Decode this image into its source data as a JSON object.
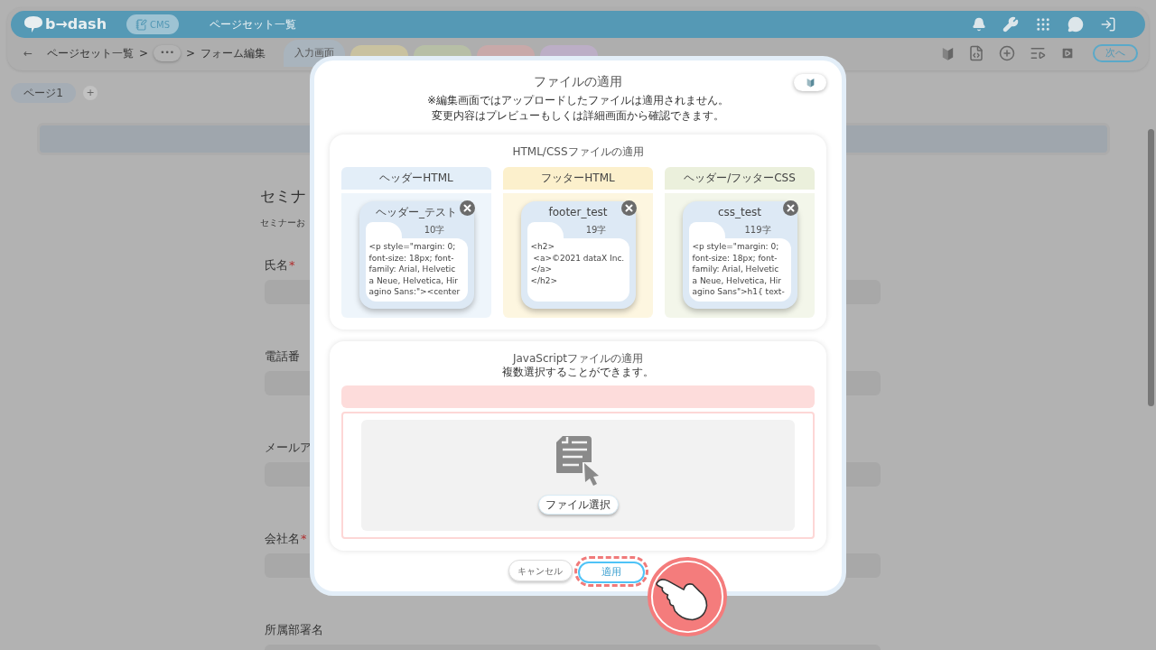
{
  "header": {
    "logo": "b→dash",
    "cms_badge": "CMS",
    "page_title": "ページセット一覧"
  },
  "breadcrumb": {
    "back": "←",
    "items": [
      {
        "kind": "link",
        "label": "ページセット一覧"
      },
      {
        "kind": "separator",
        "label": ">"
      },
      {
        "kind": "more",
        "label": "•••"
      },
      {
        "kind": "separator",
        "label": ">"
      },
      {
        "kind": "text",
        "label": "フォーム編集"
      }
    ]
  },
  "screen_tabs": [
    {
      "label": "入力画面",
      "selected": true,
      "color": "#a9b4bd"
    },
    {
      "selected": false,
      "color": "#c9c2a0"
    },
    {
      "selected": false,
      "color": "#b7bfa6"
    },
    {
      "selected": false,
      "color": "#c8a9a9"
    },
    {
      "selected": false,
      "color": "#bcaec6"
    }
  ],
  "next_button": "次へ",
  "pages": [
    {
      "label": "ページ1",
      "selected": true
    }
  ],
  "add_page": "+",
  "form": {
    "title": "セミナ",
    "description": "セミナーお",
    "required_mark": "*",
    "fields": [
      {
        "label": "氏名",
        "required": true
      },
      {
        "label": "電話番",
        "required": false
      },
      {
        "label": "メールア",
        "required": false
      },
      {
        "label": "会社名",
        "required": true
      },
      {
        "label": "所属部署名",
        "required": false
      }
    ]
  },
  "modal": {
    "title": "ファイルの適用",
    "notes": [
      "※編集画面ではアップロードしたファイルは適用されません。",
      "変更内容はプレビューもしくは詳細画面から確認できます。"
    ],
    "html_css": {
      "title": "HTML/CSSファイルの適用",
      "columns": [
        {
          "heading": "ヘッダーHTML",
          "color": "#e3eef8",
          "file": {
            "name": "ヘッダー_テスト",
            "count": "10字",
            "lines": [
              "<p style=\"margin: 0;",
              "font-size: 18px; font-",
              "family: Arial, Helvetic",
              "a Neue, Helvetica, Hir",
              "agino Sans:\"><center"
            ]
          }
        },
        {
          "heading": "フッターHTML",
          "color": "#fcf0cc",
          "file": {
            "name": "footer_test",
            "count": "19字",
            "lines": [
              "<h2>",
              " <a>©2021 dataX Inc.",
              "</a>",
              "</h2>"
            ]
          }
        },
        {
          "heading": "ヘッダー/フッターCSS",
          "color": "#ebf0dc",
          "file": {
            "name": "css_test",
            "count": "119字",
            "lines": [
              "<p style=\"margin: 0;",
              "font-size: 18px; font-",
              "family: Arial, Helvetic",
              "a Neue, Helvetica, Hir",
              "agino Sans\">h1{ text-"
            ]
          }
        }
      ]
    },
    "javascript": {
      "title": "JavaScriptファイルの適用",
      "subtitle": "複数選択することができます。",
      "select_button": "ファイル選択"
    },
    "cancel_button": "キャンセル",
    "apply_button": {
      "label": "適用",
      "highlighted": true
    }
  }
}
